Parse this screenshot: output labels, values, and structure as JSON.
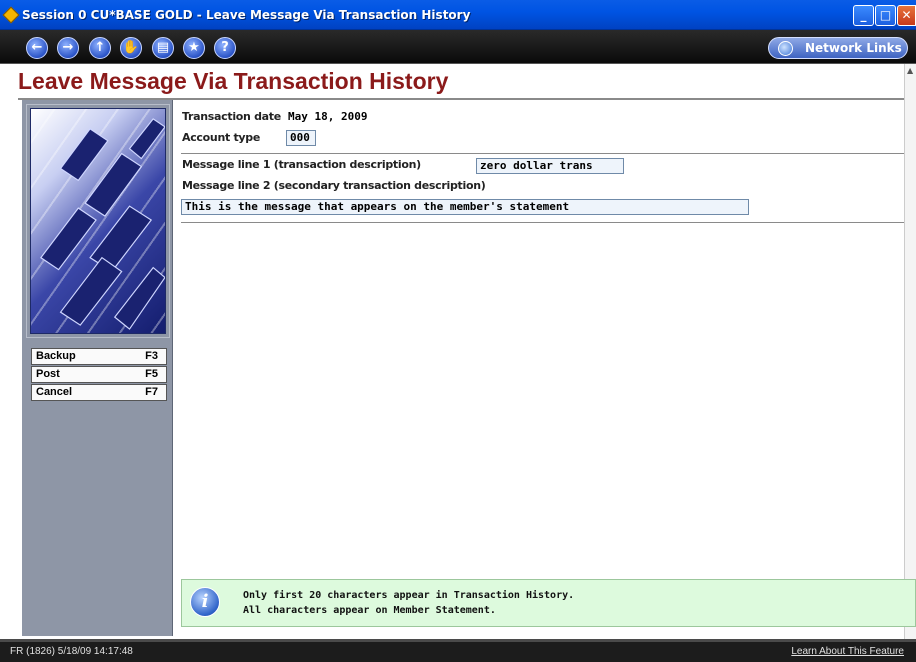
{
  "window": {
    "title": "Session 0 CU*BASE GOLD - Leave Message Via Transaction History",
    "min_symbol": "_",
    "max_symbol": "□",
    "close_symbol": "✕"
  },
  "toolbar": {
    "buttons": [
      {
        "name": "back-icon",
        "glyph": "←"
      },
      {
        "name": "forward-icon",
        "glyph": "→"
      },
      {
        "name": "up-icon",
        "glyph": "↑"
      },
      {
        "name": "hand-icon",
        "glyph": "✋"
      },
      {
        "name": "print-icon",
        "glyph": "▤"
      },
      {
        "name": "star-icon",
        "glyph": "★"
      },
      {
        "name": "help-icon",
        "glyph": "?"
      }
    ],
    "network_links_label": "Network Links"
  },
  "page": {
    "title": "Leave Message Via Transaction History"
  },
  "form": {
    "transaction_date_label": "Transaction date",
    "transaction_date_value": "May 18, 2009",
    "account_type_label": "Account type",
    "account_type_value": "000",
    "message_line1_label": "Message line 1 (transaction description)",
    "message_line1_value": "zero dollar trans",
    "message_line2_label": "Message line 2 (secondary transaction description)",
    "message_line2_value": "This is the message that appears on the member's statement"
  },
  "function_keys": [
    {
      "label": "Backup",
      "key": "F3"
    },
    {
      "label": "Post",
      "key": "F5"
    },
    {
      "label": "Cancel",
      "key": "F7"
    }
  ],
  "info": {
    "line1": "Only first 20 characters appear in Transaction History.",
    "line2": "All characters appear on Member Statement.",
    "icon_glyph": "i"
  },
  "status": {
    "left": "FR (1826) 5/18/09 14:17:48",
    "right": "Learn About This Feature"
  },
  "colors": {
    "title_accent": "#8b1a1a",
    "titlebar": "#0054e3",
    "sidebar": "#8e96a6",
    "info_background": "#ddfadd"
  }
}
